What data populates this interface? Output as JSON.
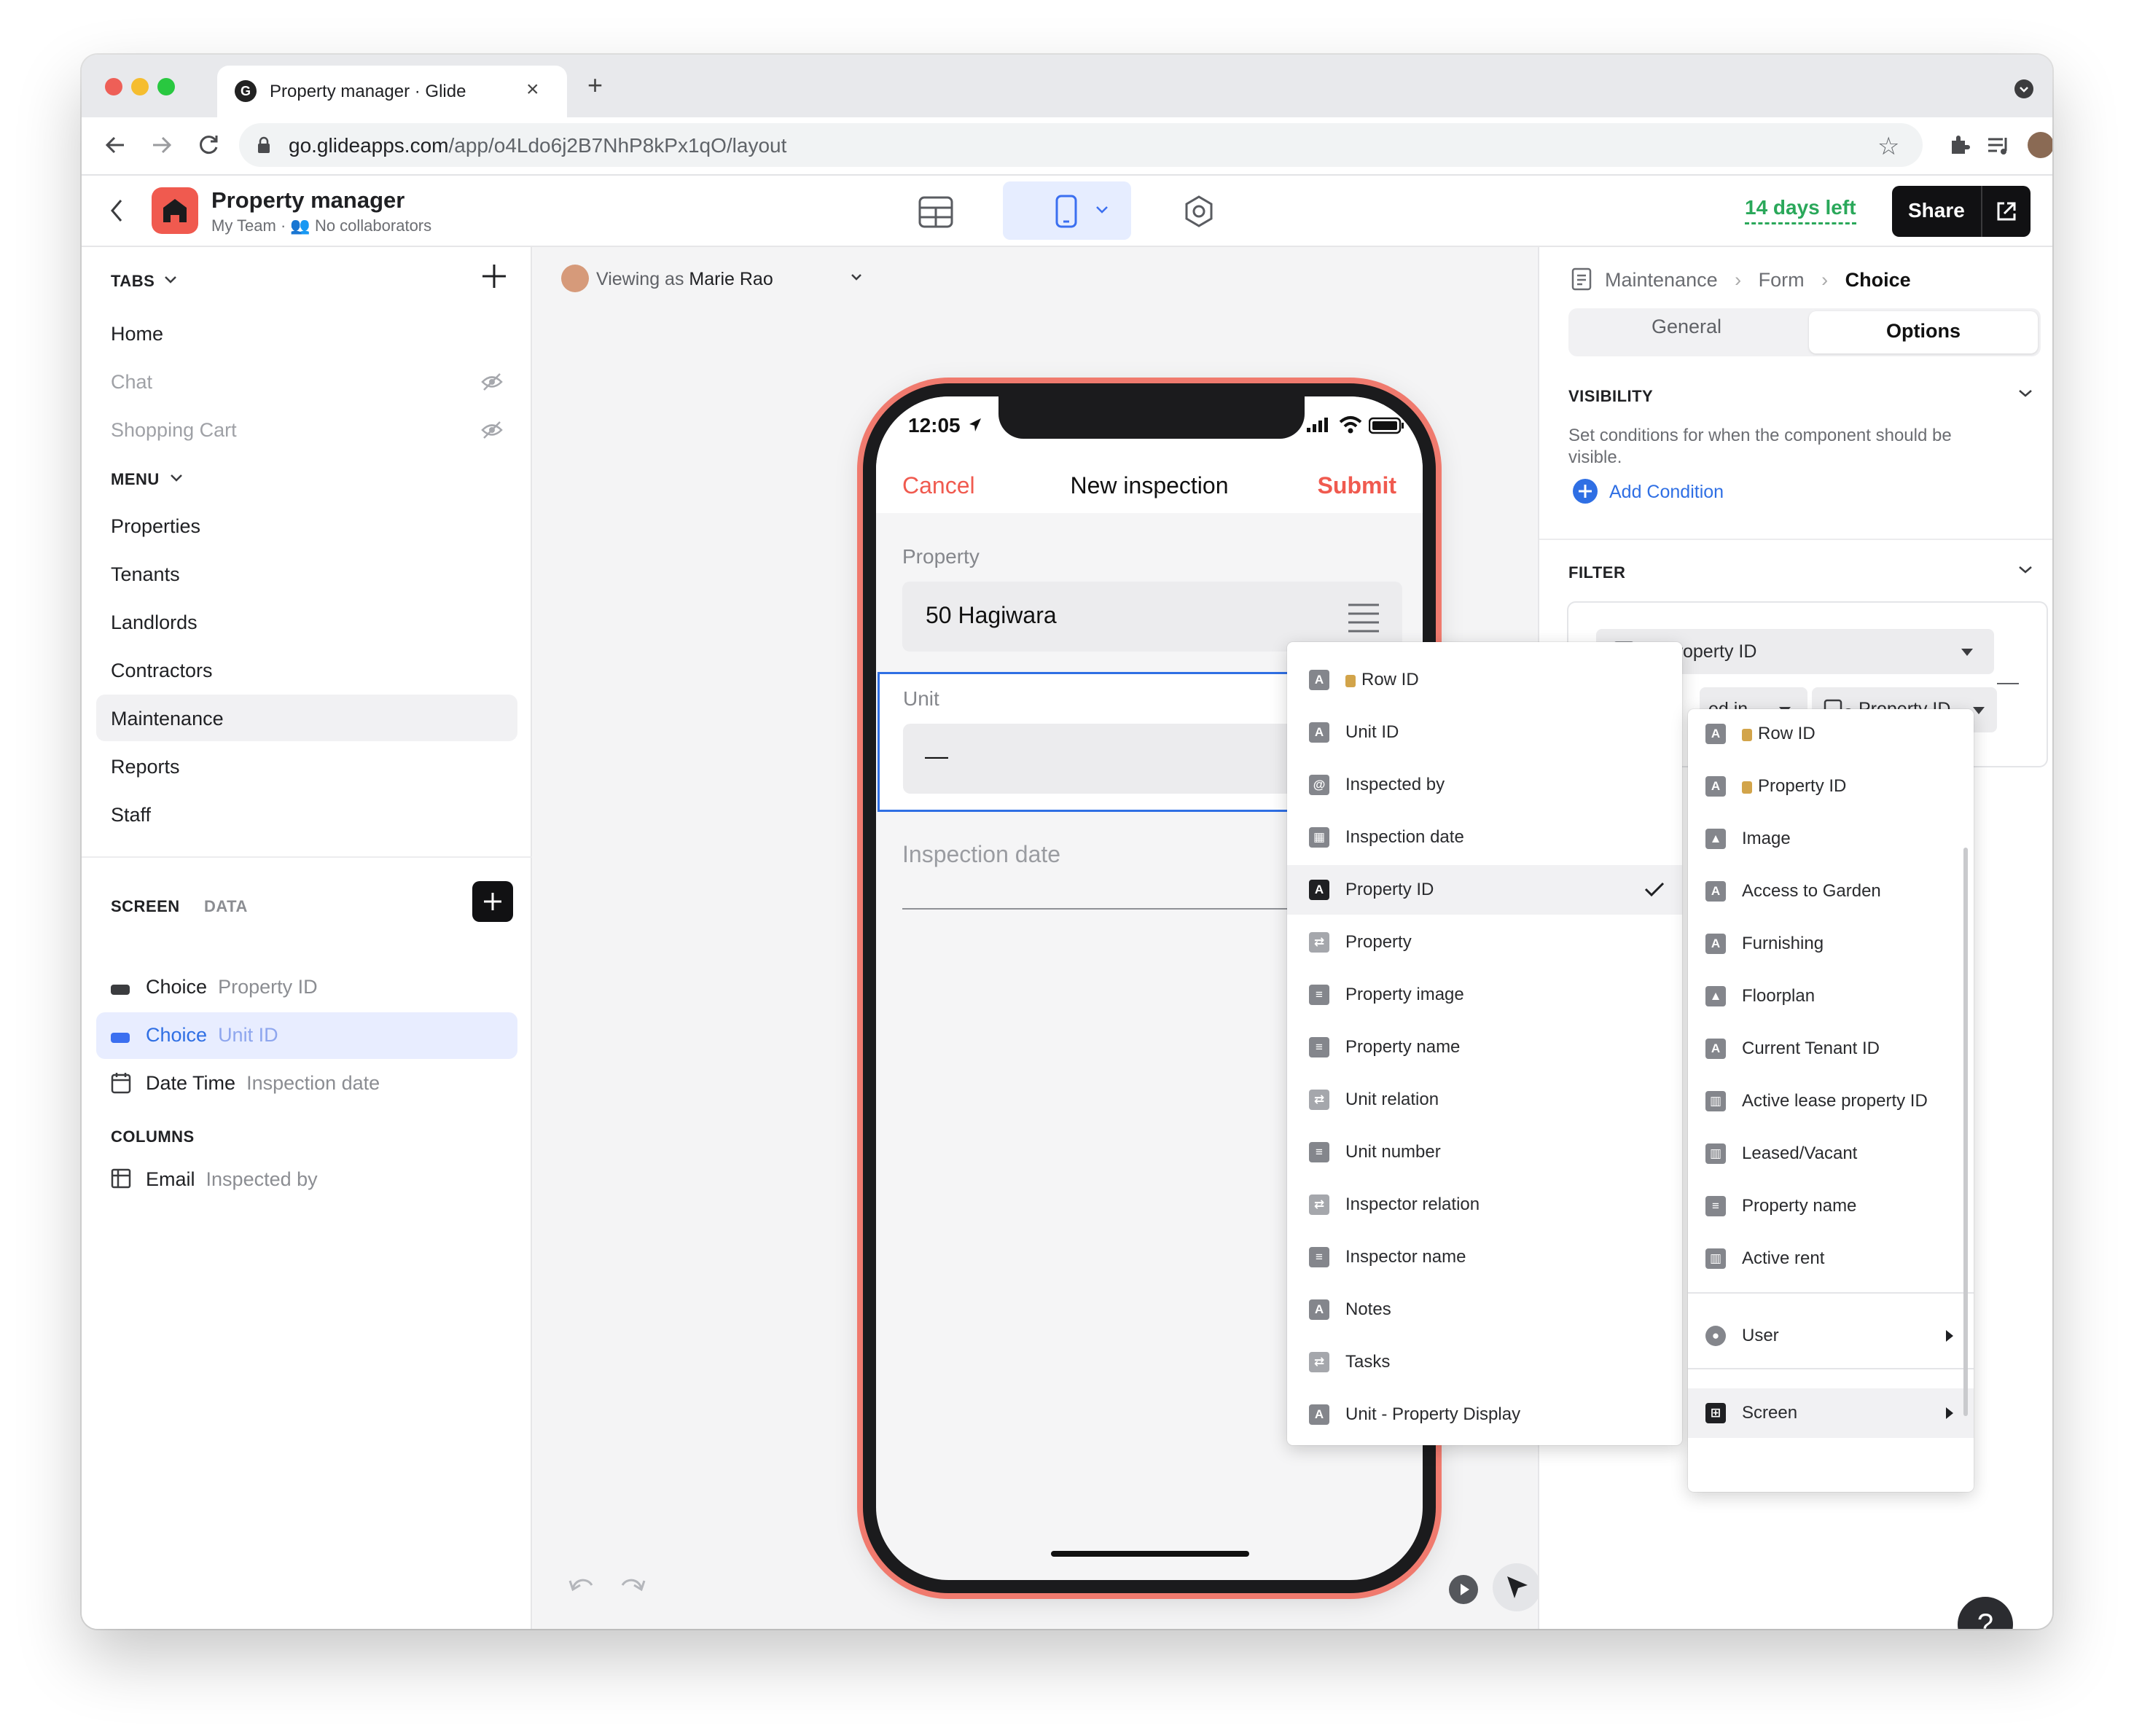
{
  "browser": {
    "tab_title": "Property manager · Glide",
    "url_host": "go.glideapps.com",
    "url_path": "/app/o4Ldo6j2B7NhP8kPx1qO/layout"
  },
  "header": {
    "app_name": "Property manager",
    "team": "My Team",
    "collaborators": "No collaborators",
    "trial": "14 days left",
    "share_label": "Share"
  },
  "sidebar": {
    "tabs_label": "TABS",
    "tabs": [
      {
        "label": "Home",
        "hidden": false
      },
      {
        "label": "Chat",
        "hidden": true
      },
      {
        "label": "Shopping Cart",
        "hidden": true
      }
    ],
    "menu_label": "MENU",
    "menu": [
      "Properties",
      "Tenants",
      "Landlords",
      "Contractors",
      "Maintenance",
      "Reports",
      "Staff"
    ],
    "selected_menu": "Maintenance",
    "screen_tab": "SCREEN",
    "data_tab": "DATA",
    "components": [
      {
        "type": "Choice",
        "column": "Property ID"
      },
      {
        "type": "Choice",
        "column": "Unit ID"
      },
      {
        "type": "Date Time",
        "column": "Inspection date"
      }
    ],
    "columns_label": "COLUMNS",
    "columns": [
      {
        "type": "Email",
        "column": "Inspected by"
      }
    ]
  },
  "canvas": {
    "viewing_as_prefix": "Viewing as",
    "viewing_as_user": "Marie Rao"
  },
  "phone": {
    "time": "12:05",
    "cancel": "Cancel",
    "title": "New inspection",
    "submit": "Submit",
    "property_label": "Property",
    "property_value": "50 Hagiwara",
    "unit_label": "Unit",
    "unit_value": "—",
    "inspection_date_label": "Inspection date"
  },
  "right_panel": {
    "breadcrumb": [
      "Maintenance",
      "Form",
      "Choice"
    ],
    "tab_general": "General",
    "tab_options": "Options",
    "visibility_title": "VISIBILITY",
    "visibility_desc": "Set conditions for when the component should be visible.",
    "add_condition": "Add Condition",
    "filter_title": "FILTER",
    "filter_column": "Property ID",
    "filter_operator_fragment": "ed in",
    "filter_value": "Property ID"
  },
  "column_menu": {
    "items": [
      {
        "label": "Row ID",
        "icon": "text-icon",
        "locked": true
      },
      {
        "label": "Unit ID",
        "icon": "text-icon"
      },
      {
        "label": "Inspected by",
        "icon": "email-icon"
      },
      {
        "label": "Inspection date",
        "icon": "calendar-icon"
      },
      {
        "label": "Property ID",
        "icon": "text-icon",
        "selected": true
      },
      {
        "label": "Property",
        "icon": "relation-icon"
      },
      {
        "label": "Property image",
        "icon": "lookup-icon"
      },
      {
        "label": "Property name",
        "icon": "lookup-icon"
      },
      {
        "label": "Unit relation",
        "icon": "relation-icon"
      },
      {
        "label": "Unit number",
        "icon": "lookup-icon"
      },
      {
        "label": "Inspector relation",
        "icon": "relation-icon"
      },
      {
        "label": "Inspector name",
        "icon": "lookup-icon"
      },
      {
        "label": "Notes",
        "icon": "text-icon"
      },
      {
        "label": "Tasks",
        "icon": "relation-icon"
      },
      {
        "label": "Unit - Property Display",
        "icon": "template-icon"
      }
    ]
  },
  "value_menu": {
    "items": [
      {
        "label": "Row ID",
        "icon": "text-icon",
        "locked": true
      },
      {
        "label": "Property ID",
        "icon": "text-icon",
        "locked": true
      },
      {
        "label": "Image",
        "icon": "image-icon"
      },
      {
        "label": "Access to Garden",
        "icon": "text-icon"
      },
      {
        "label": "Furnishing",
        "icon": "text-icon"
      },
      {
        "label": "Floorplan",
        "icon": "image-icon"
      },
      {
        "label": "Current Tenant ID",
        "icon": "text-icon"
      },
      {
        "label": "Active lease property ID",
        "icon": "rollup-icon"
      },
      {
        "label": "Leased/Vacant",
        "icon": "rollup-icon"
      },
      {
        "label": "Property name",
        "icon": "lookup-icon"
      },
      {
        "label": "Active rent",
        "icon": "rollup-icon"
      }
    ],
    "user_label": "User",
    "screen_label": "Screen"
  },
  "colors": {
    "accent_blue": "#2f6fe4",
    "brand_red": "#f05a4f",
    "trial_green": "#2aa85a",
    "selection_bg": "#e8edff"
  }
}
